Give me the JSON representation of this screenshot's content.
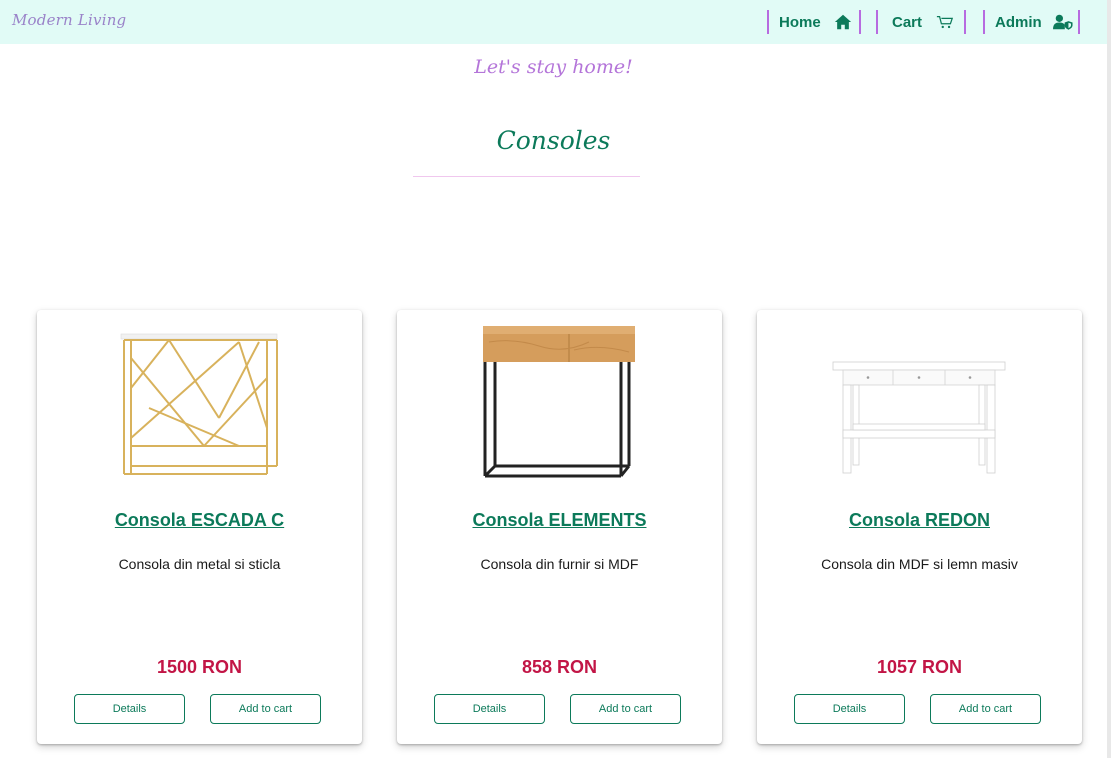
{
  "brand": "Modern Living",
  "nav": {
    "home": {
      "label": "Home",
      "icon": "home-icon"
    },
    "cart": {
      "label": "Cart",
      "icon": "cart-icon"
    },
    "admin": {
      "label": "Admin",
      "icon": "user-shield-icon"
    }
  },
  "tagline": "Let's stay home!",
  "section_title": "Consoles",
  "colors": {
    "topbar_bg": "#e1fbf6",
    "accent_green": "#0c7a5a",
    "price_red": "#c21546",
    "nav_divider_purple": "#b76be0",
    "tagline_purple": "#b475d9"
  },
  "products": [
    {
      "name": "Consola ESCADA C",
      "description": "Consola din metal si sticla",
      "price": "1500 RON",
      "details_label": "Details",
      "add_to_cart_label": "Add to cart",
      "image": "gold-geometric-console-image"
    },
    {
      "name": "Consola ELEMENTS",
      "description": "Consola din furnir si MDF",
      "price": "858 RON",
      "details_label": "Details",
      "add_to_cart_label": "Add to cart",
      "image": "wood-black-metal-console-image"
    },
    {
      "name": "Consola REDON",
      "description": "Consola din MDF si lemn masiv",
      "price": "1057 RON",
      "details_label": "Details",
      "add_to_cart_label": "Add to cart",
      "image": "white-console-with-drawers-image"
    }
  ]
}
